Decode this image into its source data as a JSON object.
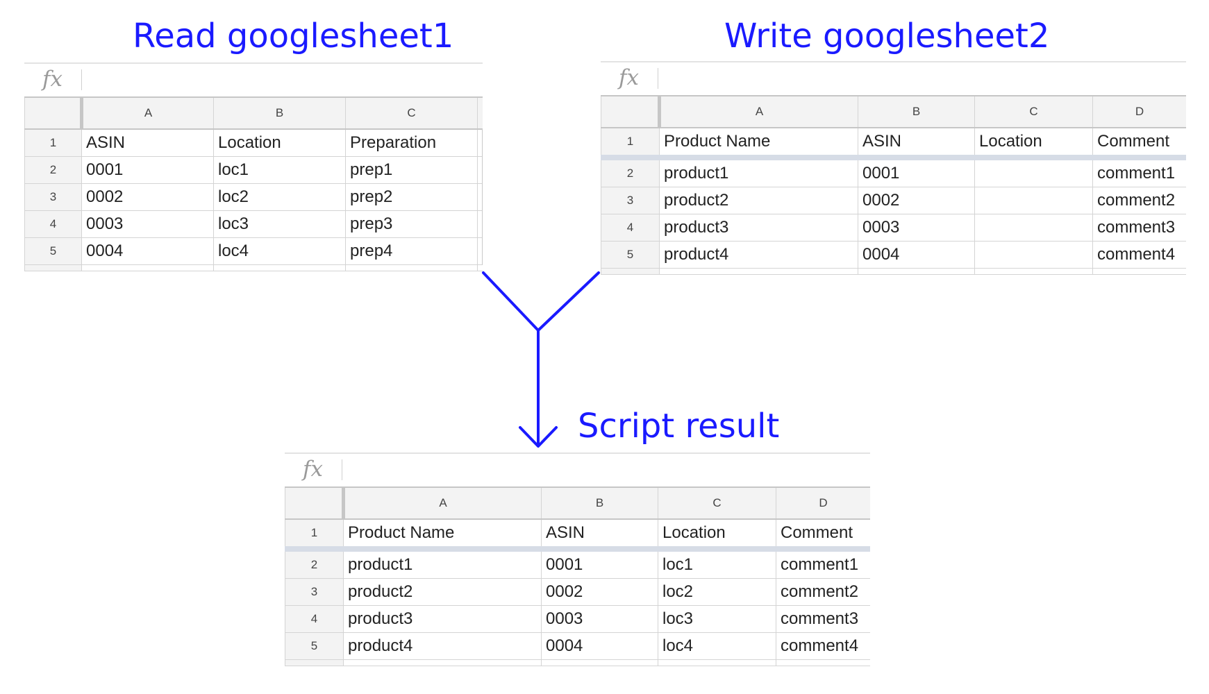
{
  "captions": {
    "read": "Read googlesheet1",
    "write": "Write googlesheet2",
    "result": "Script result"
  },
  "fx_icon": "fx-icon",
  "arrow_color": "#1a1aff",
  "sheet1": {
    "columns": [
      "A",
      "B",
      "C"
    ],
    "rows": [
      {
        "num": "1",
        "cells": [
          "ASIN",
          "Location",
          "Preparation"
        ]
      },
      {
        "num": "2",
        "cells": [
          "0001",
          "loc1",
          "prep1"
        ]
      },
      {
        "num": "3",
        "cells": [
          "0002",
          "loc2",
          "prep2"
        ]
      },
      {
        "num": "4",
        "cells": [
          "0003",
          "loc3",
          "prep3"
        ]
      },
      {
        "num": "5",
        "cells": [
          "0004",
          "loc4",
          "prep4"
        ]
      }
    ]
  },
  "sheet2": {
    "columns": [
      "A",
      "B",
      "C",
      "D"
    ],
    "rows": [
      {
        "num": "1",
        "cells": [
          "Product Name",
          "ASIN",
          "Location",
          "Comment"
        ]
      },
      {
        "num": "2",
        "cells": [
          "product1",
          "0001",
          "",
          "comment1"
        ]
      },
      {
        "num": "3",
        "cells": [
          "product2",
          "0002",
          "",
          "comment2"
        ]
      },
      {
        "num": "4",
        "cells": [
          "product3",
          "0003",
          "",
          "comment3"
        ]
      },
      {
        "num": "5",
        "cells": [
          "product4",
          "0004",
          "",
          "comment4"
        ]
      }
    ]
  },
  "sheet3": {
    "columns": [
      "A",
      "B",
      "C",
      "D"
    ],
    "rows": [
      {
        "num": "1",
        "cells": [
          "Product Name",
          "ASIN",
          "Location",
          "Comment"
        ]
      },
      {
        "num": "2",
        "cells": [
          "product1",
          "0001",
          "loc1",
          "comment1"
        ]
      },
      {
        "num": "3",
        "cells": [
          "product2",
          "0002",
          "loc2",
          "comment2"
        ]
      },
      {
        "num": "4",
        "cells": [
          "product3",
          "0003",
          "loc3",
          "comment3"
        ]
      },
      {
        "num": "5",
        "cells": [
          "product4",
          "0004",
          "loc4",
          "comment4"
        ]
      }
    ]
  }
}
